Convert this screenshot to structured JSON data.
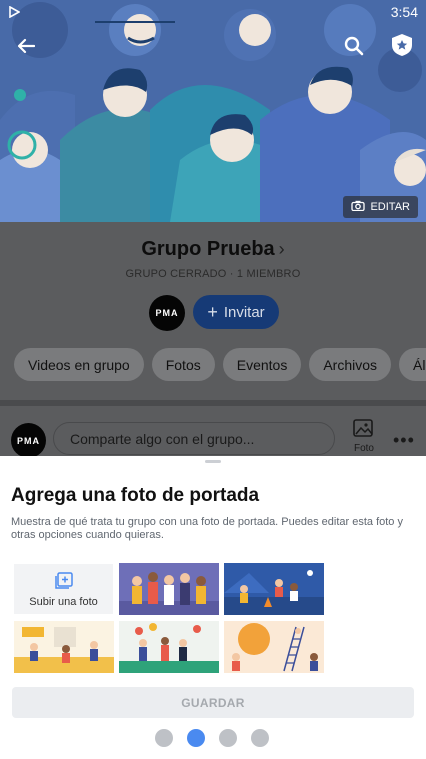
{
  "status_bar": {
    "time": "3:54"
  },
  "cover": {
    "edit_label": "EDITAR"
  },
  "group": {
    "name": "Grupo Prueba",
    "meta": "GRUPO CERRADO · 1 MIEMBRO",
    "avatar_text": "PMA",
    "invite_label": "Invitar"
  },
  "chips": [
    "Videos en grupo",
    "Fotos",
    "Eventos",
    "Archivos",
    "Álb"
  ],
  "composer": {
    "avatar_text": "PMA",
    "placeholder": "Comparte algo con el grupo...",
    "photo_label": "Foto"
  },
  "sheet": {
    "title": "Agrega una foto de portada",
    "description": "Muestra de qué trata tu grupo con una foto de portada. Puedes editar esta foto y otras opciones cuando quieras.",
    "upload_label": "Subir una foto",
    "save_label": "GUARDAR",
    "thumbnails": [
      "illustration-group-people",
      "illustration-campfire",
      "illustration-cafe",
      "illustration-street-party",
      "illustration-sun-ladder"
    ],
    "page_dots": {
      "count": 4,
      "active_index": 1
    }
  },
  "colors": {
    "accent": "#4a8af0",
    "invite_bg": "#163a76",
    "cover_bg": "#486aa8"
  }
}
